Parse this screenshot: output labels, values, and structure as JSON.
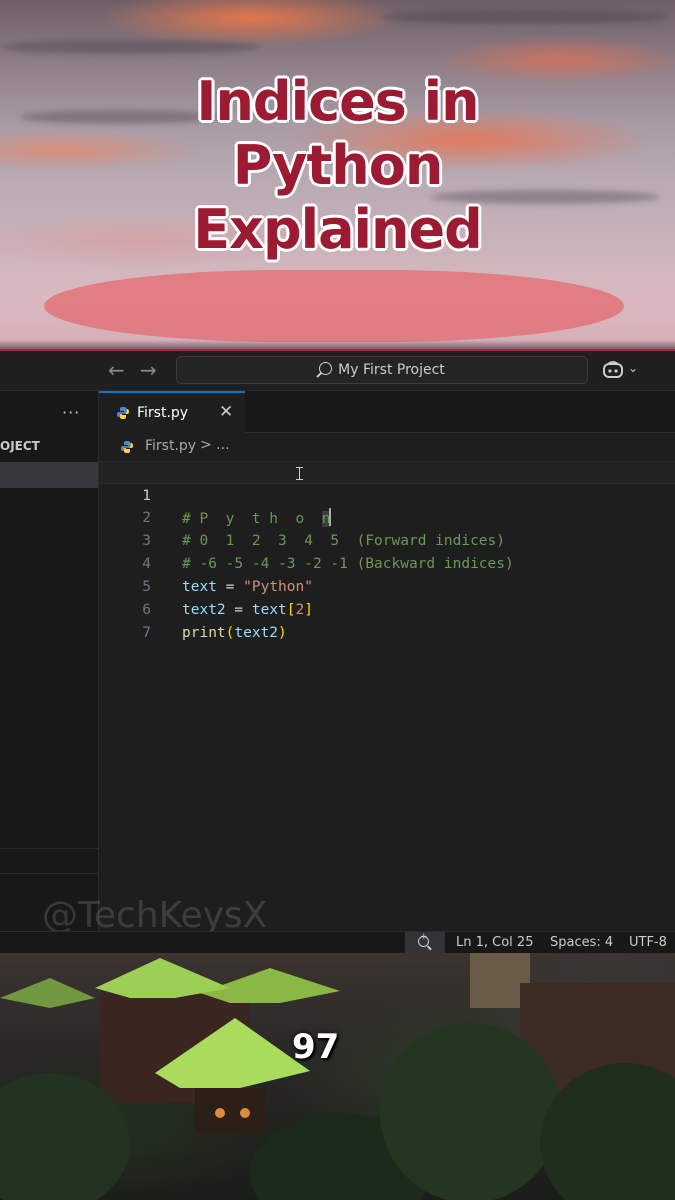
{
  "banner": {
    "title_lines": [
      "Indices in",
      "Python",
      "Explained"
    ]
  },
  "titlebar": {
    "back_icon": "arrow-left-icon",
    "forward_icon": "arrow-right-icon",
    "search_text": "My First Project",
    "copilot_icon": "copilot-icon",
    "chevron": "⌄"
  },
  "sidebar": {
    "more_label": "···",
    "project_label": "OJECT"
  },
  "tab": {
    "label": "First.py",
    "close": "✕"
  },
  "breadcrumb": {
    "file": "First.py",
    "chevron": "> ..."
  },
  "code": {
    "line_numbers": [
      "1",
      "2",
      "3",
      "4",
      "5",
      "6",
      "7"
    ],
    "line1_prefix": "# P  y  t",
    "line1_mid": " h  o  ",
    "line1_sel": "n",
    "line2": "# 0  1  2  3  4  5  (Forward indices)",
    "line3": "# -6 -5 -4 -3 -2 -1 (Backward indices)",
    "line4_var": "text",
    "line4_op": " = ",
    "line4_str": "\"Python\"",
    "line5_var": "text2",
    "line5_op": " = ",
    "line5_var2": "text",
    "line5_lb": "[",
    "line5_num": "2",
    "line5_rb": "]",
    "line6_fn": "print",
    "line6_lp": "(",
    "line6_arg": "text2",
    "line6_rp": ")"
  },
  "watermark": "@TechKeysX",
  "statusbar": {
    "zoom_icon": "zoom-in-icon",
    "position": "Ln 1, Col 25",
    "spaces": "Spaces: 4",
    "encoding": "UTF-8"
  },
  "overlay": {
    "counter": "97"
  },
  "colors": {
    "title": "#9c1a32",
    "accent_border": "#a3283c",
    "editor_bg": "#1e1e1e",
    "comment": "#6a9955",
    "string": "#ce9178",
    "variable": "#9cdcfe",
    "function": "#dcdcaa"
  }
}
